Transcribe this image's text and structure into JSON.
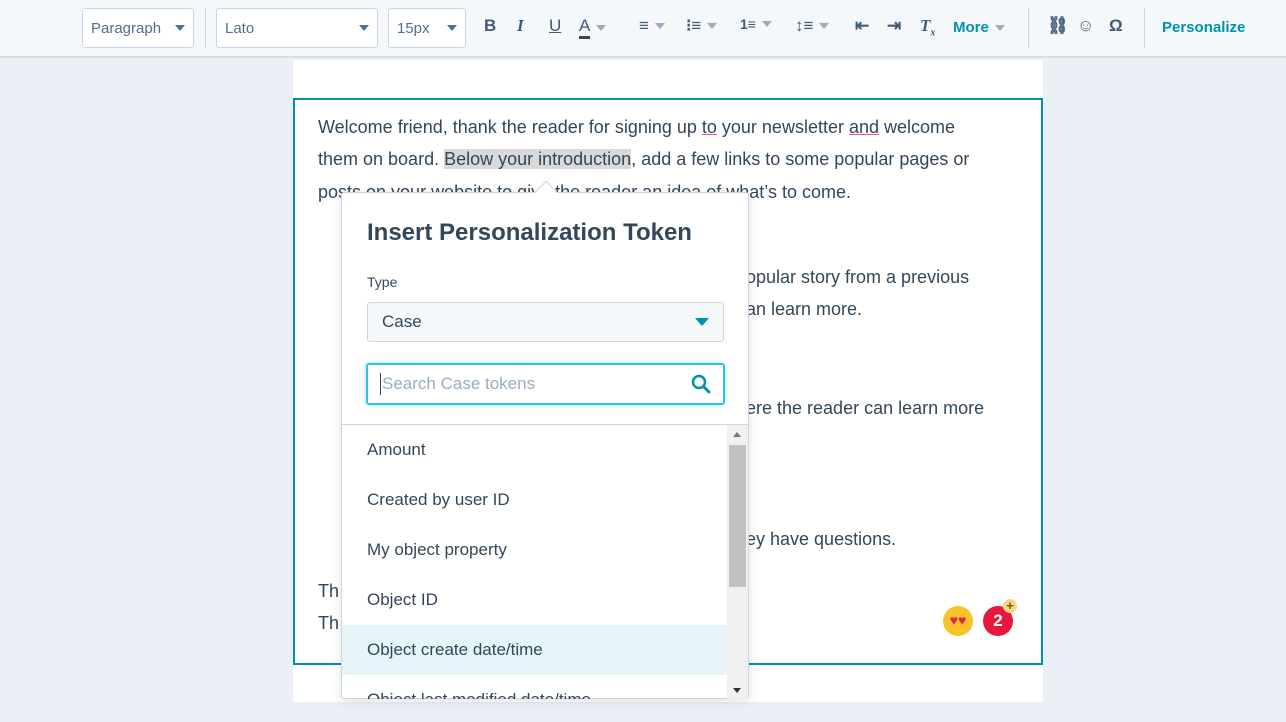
{
  "toolbar": {
    "block_format": "Paragraph",
    "font": "Lato",
    "size": "15px",
    "bold": "B",
    "italic": "I",
    "underline": "U",
    "text_color": "A",
    "more_label": "More",
    "personalize_label": "Personalize",
    "special_char": "Ω"
  },
  "editor": {
    "lines": [
      "Welcome friend, thank the reader for signing up ",
      "to",
      " your newsletter ",
      "and",
      " welcome"
    ],
    "line2a": "them on board. ",
    "line2b": "Below your introduction",
    "line2c": ", add a few links to some popular pages or",
    "line3": "posts on your website to give the reader an idea of what’s to come.",
    "frag1": "opular story from a previous",
    "frag2": "an learn more.",
    "frag3": "ere the reader can learn more",
    "frag4": "ey have questions.",
    "left1": "Th",
    "left2": "Th",
    "badge_count": "2"
  },
  "popup": {
    "title": "Insert Personalization Token",
    "type_label": "Type",
    "type_value": "Case",
    "search_placeholder": "Search Case tokens",
    "items": [
      "Amount",
      "Created by user ID",
      "My object property",
      "Object ID",
      "Object create date/time",
      "Object last modified date/time"
    ],
    "highlighted": "Object create date/time"
  }
}
